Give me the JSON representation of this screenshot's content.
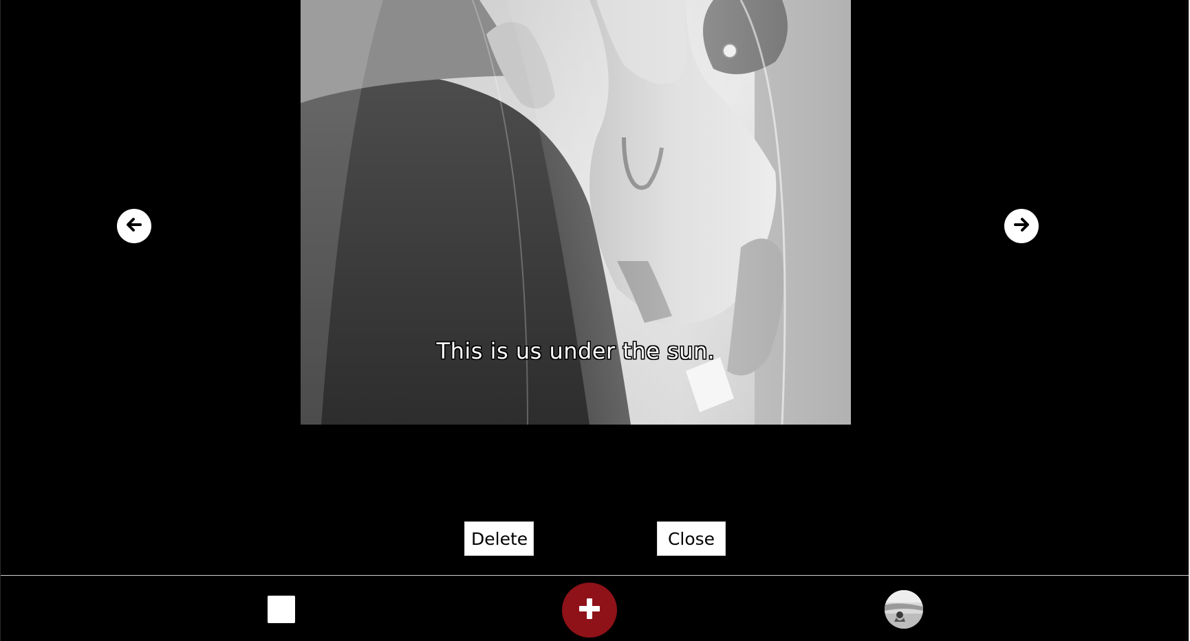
{
  "viewer": {
    "caption": "This is us under the sun.",
    "prev_icon": "arrow-left-icon",
    "next_icon": "arrow-right-icon",
    "photo_description_icon": "wedding-photo"
  },
  "actions": {
    "delete_label": "Delete",
    "close_label": "Close"
  },
  "bottom_bar": {
    "add_icon": "plus-icon",
    "accent_color": "#8f1219"
  }
}
